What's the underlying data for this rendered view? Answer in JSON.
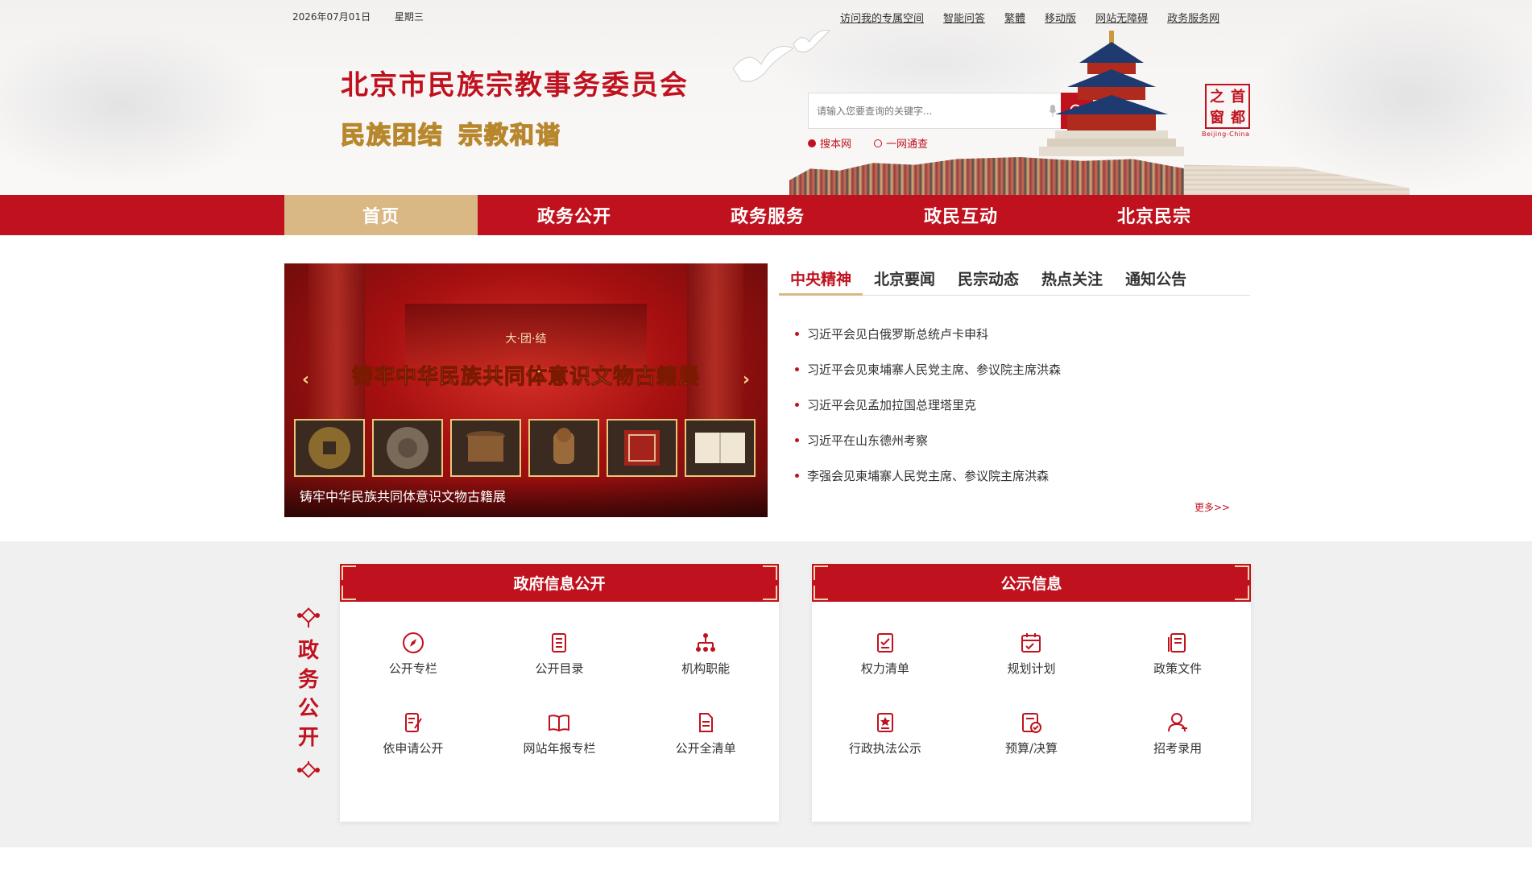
{
  "topbar": {
    "date": "2026年07月01日",
    "weekday": "星期三",
    "links": [
      "访问我的专属空间",
      "智能问答",
      "繁體",
      "移动版",
      "网站无障碍",
      "政务服务网"
    ]
  },
  "header": {
    "site_title": "北京市民族宗教事务委员会",
    "slogan": [
      "民族团结",
      "宗教和谐"
    ],
    "logo_chars": [
      "首",
      "都",
      "之",
      "窗"
    ],
    "logo_sub": "Beijing-China"
  },
  "search": {
    "placeholder": "请输入您要查询的关键字...",
    "scopes": [
      "搜本网",
      "一网通查"
    ],
    "selected_scope": "搜本网"
  },
  "nav": {
    "items": [
      "首页",
      "政务公开",
      "政务服务",
      "政民互动",
      "北京民宗"
    ],
    "active": "首页"
  },
  "banner": {
    "top_text": "大·团·结",
    "headline": "铸牢中华民族共同体意识文物古籍展",
    "caption": "铸牢中华民族共同体意识文物古籍展"
  },
  "news": {
    "tabs": [
      "中央精神",
      "北京要闻",
      "民宗动态",
      "热点关注",
      "通知公告"
    ],
    "active_tab": "中央精神",
    "items": [
      "习近平会见白俄罗斯总统卢卡申科",
      "习近平会见柬埔寨人民党主席、参议院主席洪森",
      "习近平会见孟加拉国总理塔里克",
      "习近平在山东德州考察",
      "李强会见柬埔寨人民党主席、参议院主席洪森"
    ],
    "more": "更多>>"
  },
  "section": {
    "side_label": [
      "政",
      "务",
      "公",
      "开"
    ]
  },
  "cards": {
    "left": {
      "title": "政府信息公开",
      "items": [
        {
          "label": "公开专栏",
          "icon": "compass-icon"
        },
        {
          "label": "公开目录",
          "icon": "list-icon"
        },
        {
          "label": "机构职能",
          "icon": "org-chart-icon"
        },
        {
          "label": "依申请公开",
          "icon": "edit-doc-icon"
        },
        {
          "label": "网站年报专栏",
          "icon": "book-icon"
        },
        {
          "label": "公开全清单",
          "icon": "document-icon"
        }
      ]
    },
    "right": {
      "title": "公示信息",
      "items": [
        {
          "label": "权力清单",
          "icon": "checklist-icon"
        },
        {
          "label": "规划计划",
          "icon": "calendar-icon"
        },
        {
          "label": "政策文件",
          "icon": "policy-doc-icon"
        },
        {
          "label": "行政执法公示",
          "icon": "badge-doc-icon"
        },
        {
          "label": "预算/决算",
          "icon": "budget-icon"
        },
        {
          "label": "招考录用",
          "icon": "user-icon"
        }
      ]
    }
  },
  "colors": {
    "primary_red": "#c0121e",
    "gold": "#d9b883",
    "gray_bg": "#f0f0f0"
  }
}
